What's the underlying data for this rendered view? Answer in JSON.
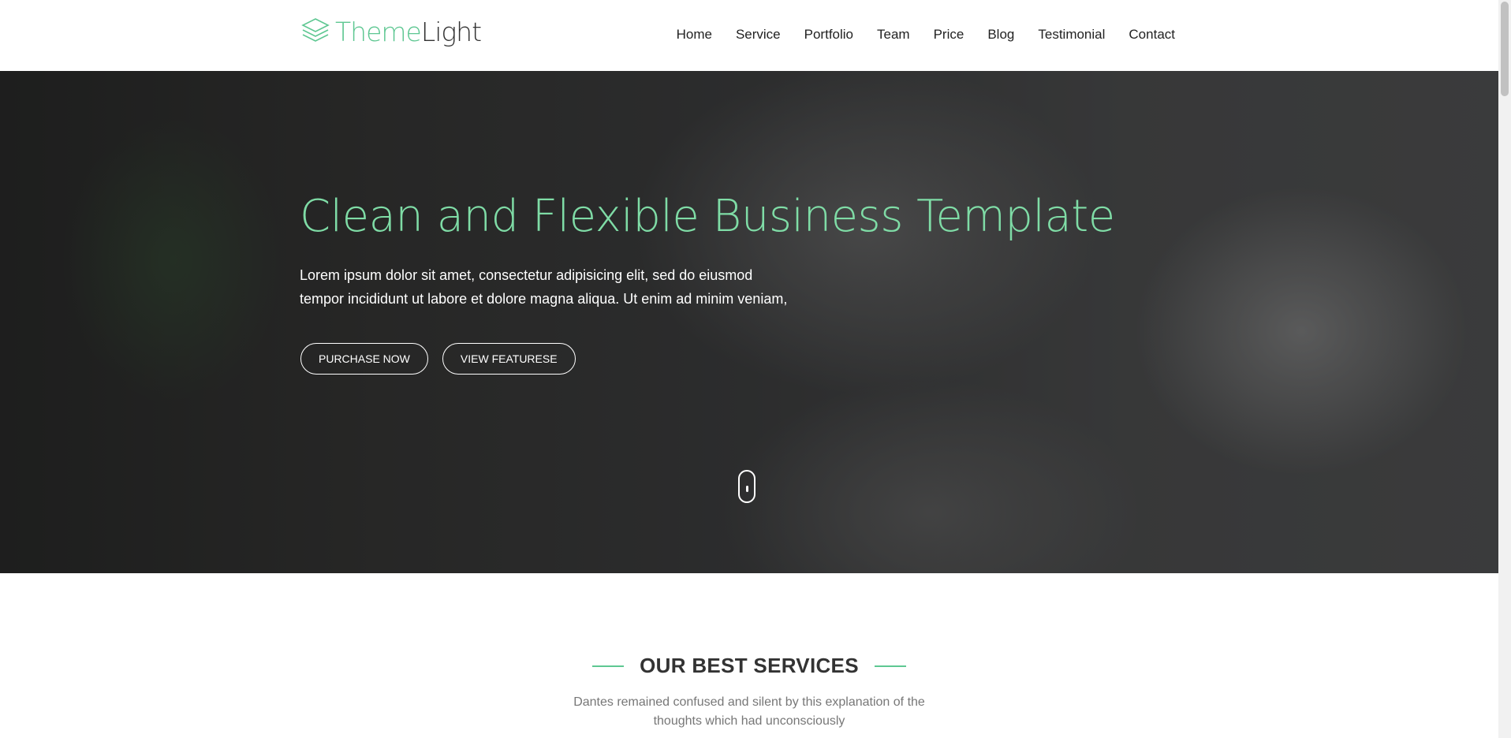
{
  "brand": {
    "part1": "Theme",
    "part2": "Light",
    "icon": "layers-icon"
  },
  "nav": {
    "items": [
      {
        "label": "Home"
      },
      {
        "label": "Service"
      },
      {
        "label": "Portfolio"
      },
      {
        "label": "Team"
      },
      {
        "label": "Price"
      },
      {
        "label": "Blog"
      },
      {
        "label": "Testimonial"
      },
      {
        "label": "Contact"
      }
    ]
  },
  "hero": {
    "title": "Clean and Flexible Business Template",
    "text_line1": "Lorem ipsum dolor sit amet, consectetur adipisicing elit, sed do eiusmod",
    "text_line2": "tempor incididunt ut labore et dolore magna aliqua. Ut enim ad minim veniam,",
    "button_primary": "PURCHASE NOW",
    "button_secondary": "VIEW FEATURESE",
    "scroll_icon": "mouse-scroll-icon"
  },
  "services": {
    "title": "OUR BEST SERVICES",
    "text_line1": "Dantes remained confused and silent by this explanation of the",
    "text_line2": "thoughts which had unconsciously"
  },
  "colors": {
    "accent": "#5ec792",
    "hero_title": "#7fdca6",
    "text_dark": "#222222",
    "text_muted": "#777777"
  }
}
